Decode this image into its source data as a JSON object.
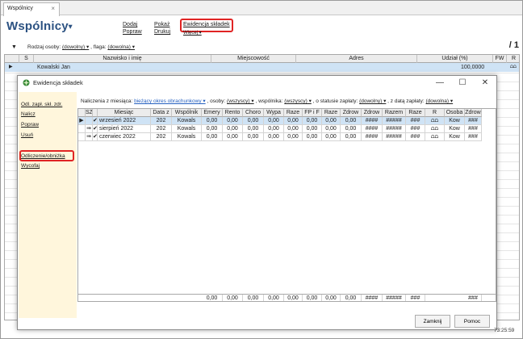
{
  "tab": {
    "label": "Wspólnicy",
    "close": "×"
  },
  "page": {
    "title": "Wspólnicy",
    "title_caret": "▾",
    "page_count": "/ 1"
  },
  "toolbar": {
    "dodaj": "Dodaj",
    "popraw": "Popraw",
    "pokaz": "Pokaż",
    "drukuj": "Drukuj",
    "ewidencja": "Ewidencja składek",
    "wiecej": "Więcej ▾"
  },
  "filter": {
    "label_rodzaj": "Rodzaj osoby:",
    "rodzaj_value": "(dowolny) ▾",
    "label_flaga": ", flaga:",
    "flaga_value": "(dowolna) ▾"
  },
  "main_table": {
    "headers": [
      "S",
      "Nazwisko i imię",
      "Miejscowość",
      "Adres",
      "Udział (%)",
      "FW",
      "R"
    ],
    "row": {
      "nazwisko": "Kowalski Jan",
      "udzial": "100,0000",
      "r": "⩍⩍"
    }
  },
  "dialog": {
    "title": "Ewidencja składek",
    "sidebar": [
      "Odl. zapł. skł. zdr.",
      "Nalicz",
      "Popraw",
      "Usuń",
      "Odliczenie/obniżka",
      "Wycofaj"
    ],
    "filter": {
      "nal_label": "Naliczenia z miesiąca:",
      "nal_value": "bieżący okres obrachunkowy ▾",
      "osoby_label": ", osoby:",
      "osoby_value": "(wszyscy) ▾",
      "wsp_label": ", wspólnika:",
      "wsp_value": "(wszyscy) ▾",
      "status_label": ", o statusie zapłaty:",
      "status_value": "(dowolny) ▾",
      "data_label": ", z datą zapłaty:",
      "data_value": "(dowolna) ▾"
    },
    "headers": [
      "",
      "SZ",
      "",
      "Miesiąc",
      "Data z",
      "Wspólnik",
      "Emery",
      "Rento",
      "Choro",
      "Wypa",
      "Raze",
      "FP i F",
      "Raze",
      "Zdrow",
      "Zdrow",
      "Razem",
      "Raze",
      "R",
      "Osoba",
      "Zdrow"
    ],
    "rows": [
      {
        "marker": "▶",
        "sz": "",
        "mark": "✔",
        "miesiac": "wrzesień 2022",
        "data": "202",
        "wsp": "Kowals",
        "vals": [
          "0,00",
          "0,00",
          "0,00",
          "0,00",
          "0,00",
          "0,00",
          "0,00",
          "0,00",
          "####",
          "#####",
          "###"
        ],
        "r": "⩍⩍",
        "osoba": "Kow",
        "zdrow": "###"
      },
      {
        "marker": "",
        "sz": "⇛",
        "mark": "✔",
        "miesiac": "sierpień 2022",
        "data": "202",
        "wsp": "Kowals",
        "vals": [
          "0,00",
          "0,00",
          "0,00",
          "0,00",
          "0,00",
          "0,00",
          "0,00",
          "0,00",
          "####",
          "#####",
          "###"
        ],
        "r": "⩍⩍",
        "osoba": "Kow",
        "zdrow": "###"
      },
      {
        "marker": "",
        "sz": "⇛",
        "mark": "✔",
        "miesiac": "czerwiec 2022",
        "data": "202",
        "wsp": "Kowals",
        "vals": [
          "0,00",
          "0,00",
          "0,00",
          "0,00",
          "0,00",
          "0,00",
          "0,00",
          "0,00",
          "####",
          "#####",
          "###"
        ],
        "r": "⩍⩍",
        "osoba": "Kow",
        "zdrow": "###"
      }
    ],
    "totals": [
      "0,00",
      "0,00",
      "0,00",
      "0,00",
      "0,00",
      "0,00",
      "0,00",
      "0,00",
      "####",
      "#####",
      "###"
    ],
    "totals_last": "###",
    "buttons": {
      "close": "Zamknij",
      "help": "Pomoc"
    }
  },
  "status": {
    "time": "73:25:59"
  },
  "colors": {
    "accent": "#2c5282",
    "highlight": "#e02424",
    "selection": "#cfe3f5",
    "sidebar": "#fff6dc"
  }
}
